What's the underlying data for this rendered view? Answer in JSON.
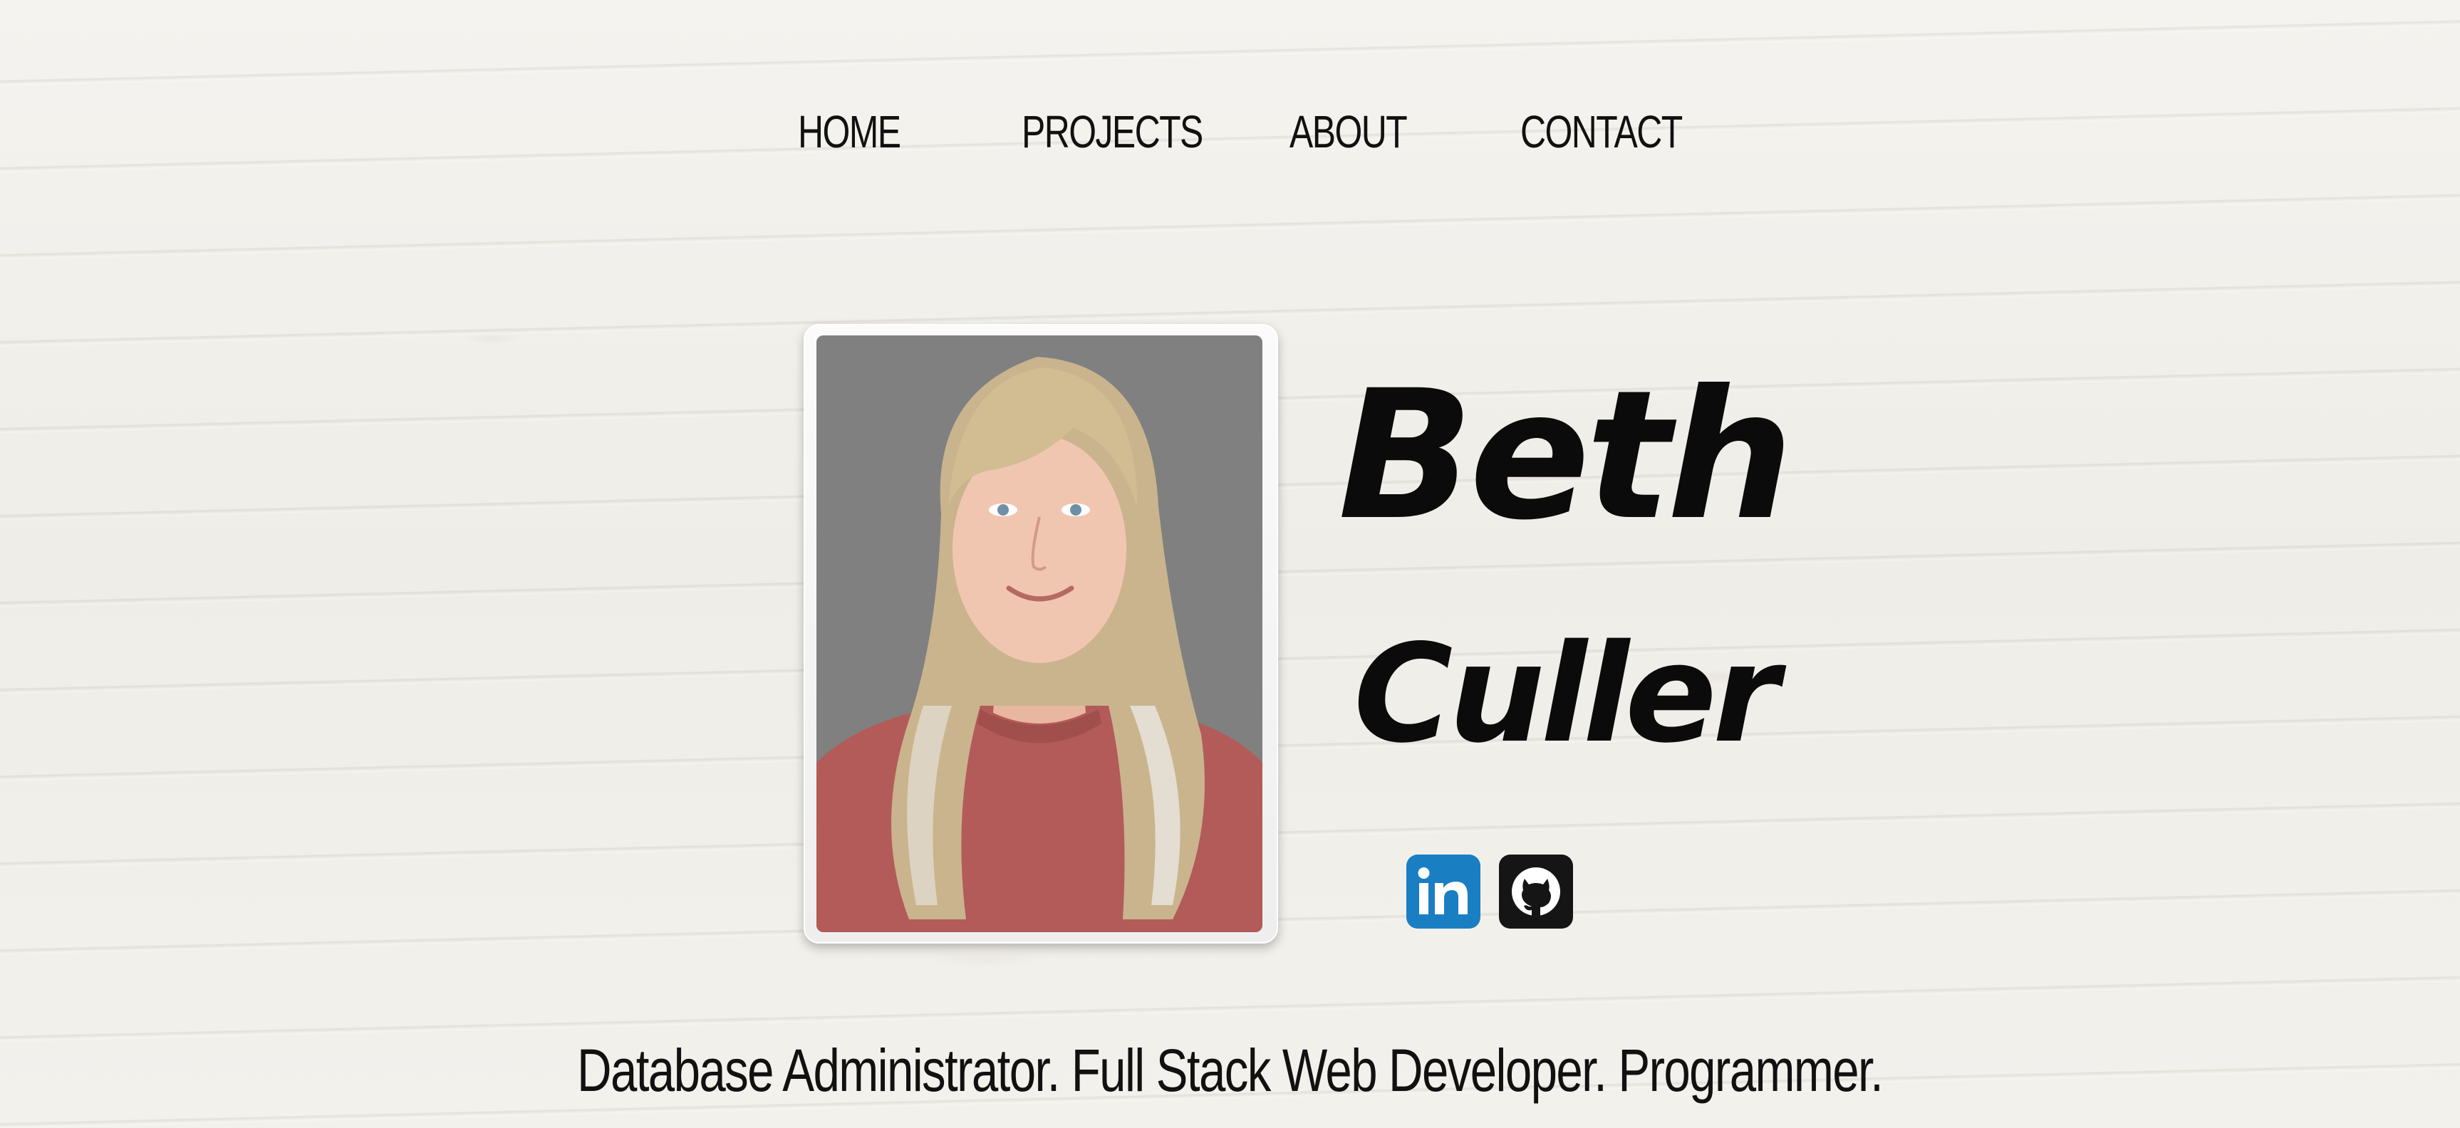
{
  "nav": {
    "items": [
      {
        "label": "HOME"
      },
      {
        "label": "PROJECTS"
      },
      {
        "label": "ABOUT"
      },
      {
        "label": "CONTACT"
      }
    ]
  },
  "hero": {
    "first_name": "Beth",
    "last_name": "Culler",
    "photo_icon": "portrait-photo",
    "social": [
      {
        "icon": "linkedin-icon",
        "label": "in",
        "color": "#1a7ec2"
      },
      {
        "icon": "github-icon",
        "color": "#151515"
      }
    ]
  },
  "tagline": "Database Administrator. Full Stack Web Developer. Programmer.",
  "colors": {
    "background": "#f1efea",
    "text": "#111111",
    "photo_background": "#808080"
  }
}
